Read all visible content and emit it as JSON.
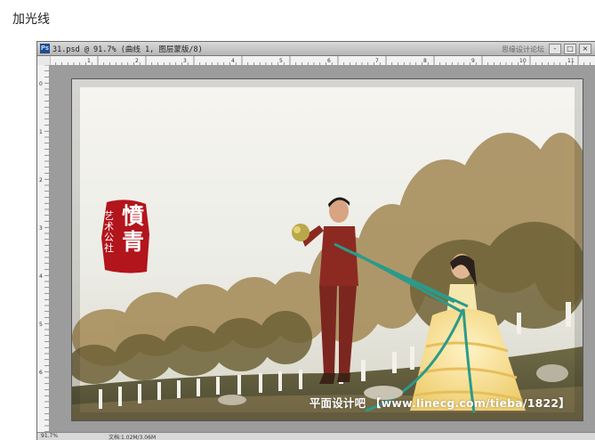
{
  "page": {
    "heading": "加光线"
  },
  "document": {
    "title": "31.psd @ 91.7% (曲线 1, 图层蒙版/8)",
    "watermark": "思缘设计论坛",
    "window_buttons": [
      "-",
      "□",
      "×"
    ]
  },
  "ruler": {
    "top_labels": [
      "1",
      "2",
      "3",
      "4",
      "5",
      "6",
      "7",
      "8",
      "9",
      "10",
      "11"
    ],
    "left_labels": [
      "0",
      "1",
      "2",
      "3",
      "4",
      "5",
      "6"
    ]
  },
  "photo": {
    "caption": "平面设计吧 【www.linecg.com/tieba/1822】",
    "seal_big": "憤青",
    "seal_small": "艺术公社"
  },
  "status": {
    "zoom": "91.7%",
    "info": "文档:1.02M/3.06M"
  },
  "colors": {
    "seal_red": "#b2151c",
    "suit_red": "#8c2a22",
    "dress_yellow": "#f4dc8c",
    "ribbon_teal": "#2b9a8a"
  },
  "icons": [
    "photoshop-icon",
    "minimize-icon",
    "maximize-icon",
    "close-icon"
  ]
}
